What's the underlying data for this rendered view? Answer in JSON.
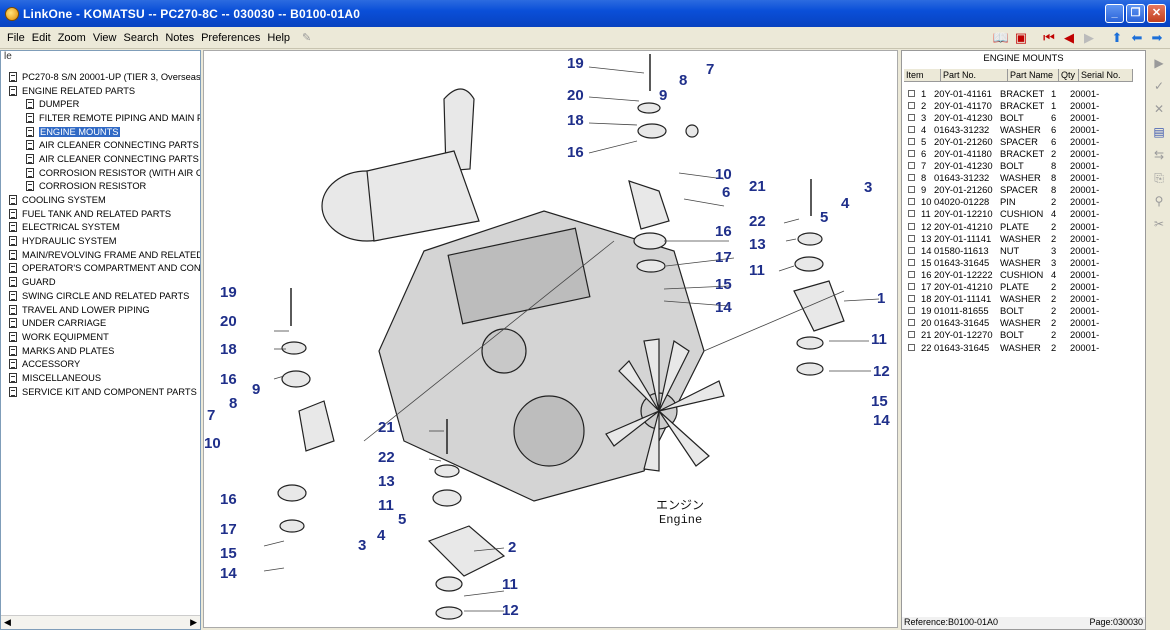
{
  "window": {
    "title": "LinkOne - KOMATSU -- PC270-8C -- 030030 -- B0100-01A0"
  },
  "menu": [
    "File",
    "Edit",
    "Zoom",
    "View",
    "Search",
    "Notes",
    "Preferences",
    "Help"
  ],
  "left_panel": {
    "header": "le",
    "tree": [
      {
        "label": "PC270-8 S/N 20001-UP (TIER 3, Overseas",
        "level": 1
      },
      {
        "label": "ENGINE RELATED PARTS",
        "level": 1
      },
      {
        "label": "DUMPER",
        "level": 2
      },
      {
        "label": "FILTER REMOTE PIPING AND MAIN PU",
        "level": 2
      },
      {
        "label": "ENGINE MOUNTS",
        "level": 2,
        "selected": true
      },
      {
        "label": "AIR CLEANER CONNECTING PARTS",
        "level": 2
      },
      {
        "label": "AIR CLEANER CONNECTING PARTS (W",
        "level": 2
      },
      {
        "label": "CORROSION RESISTOR (WITH AIR CC",
        "level": 2
      },
      {
        "label": "CORROSION RESISTOR",
        "level": 2
      },
      {
        "label": "COOLING SYSTEM",
        "level": 1
      },
      {
        "label": "FUEL TANK AND RELATED PARTS",
        "level": 1
      },
      {
        "label": "ELECTRICAL SYSTEM",
        "level": 1
      },
      {
        "label": "HYDRAULIC SYSTEM",
        "level": 1
      },
      {
        "label": "MAIN/REVOLVING FRAME AND RELATED P",
        "level": 1
      },
      {
        "label": "OPERATOR'S COMPARTMENT AND CONTR",
        "level": 1
      },
      {
        "label": "GUARD",
        "level": 1
      },
      {
        "label": "SWING CIRCLE AND RELATED PARTS",
        "level": 1
      },
      {
        "label": "TRAVEL AND LOWER PIPING",
        "level": 1
      },
      {
        "label": "UNDER CARRIAGE",
        "level": 1
      },
      {
        "label": "WORK EQUIPMENT",
        "level": 1
      },
      {
        "label": "MARKS AND PLATES",
        "level": 1
      },
      {
        "label": "ACCESSORY",
        "level": 1
      },
      {
        "label": "MISCELLANEOUS",
        "level": 1
      },
      {
        "label": "SERVICE KIT AND COMPONENT PARTS",
        "level": 1
      }
    ]
  },
  "diagram": {
    "caption_jp": "エンジン",
    "caption_en": "Engine",
    "callouts": [
      "19",
      "8",
      "7",
      "20",
      "9",
      "18",
      "16",
      "10",
      "6",
      "21",
      "3",
      "22",
      "5",
      "4",
      "16",
      "13",
      "17",
      "11",
      "15",
      "14",
      "1",
      "19",
      "20",
      "18",
      "16",
      "9",
      "7",
      "8",
      "10",
      "16",
      "17",
      "15",
      "14",
      "21",
      "22",
      "13",
      "11",
      "5",
      "2",
      "3",
      "4",
      "11",
      "12",
      "11",
      "12",
      "15",
      "14"
    ]
  },
  "parts_panel": {
    "title": "ENGINE MOUNTS",
    "columns": [
      "Item",
      "Part No.",
      "Part Name",
      "Qty",
      "Serial No."
    ],
    "rows": [
      [
        "1",
        "20Y-01-41161",
        "BRACKET",
        "1",
        "20001-"
      ],
      [
        "2",
        "20Y-01-41170",
        "BRACKET",
        "1",
        "20001-"
      ],
      [
        "3",
        "20Y-01-41230",
        "BOLT",
        "6",
        "20001-"
      ],
      [
        "4",
        "01643-31232",
        "WASHER",
        "6",
        "20001-"
      ],
      [
        "5",
        "20Y-01-21260",
        "SPACER",
        "6",
        "20001-"
      ],
      [
        "6",
        "20Y-01-41180",
        "BRACKET",
        "2",
        "20001-"
      ],
      [
        "7",
        "20Y-01-41230",
        "BOLT",
        "8",
        "20001-"
      ],
      [
        "8",
        "01643-31232",
        "WASHER",
        "8",
        "20001-"
      ],
      [
        "9",
        "20Y-01-21260",
        "SPACER",
        "8",
        "20001-"
      ],
      [
        "10",
        "04020-01228",
        "PIN",
        "2",
        "20001-"
      ],
      [
        "11",
        "20Y-01-12210",
        "CUSHION",
        "4",
        "20001-"
      ],
      [
        "12",
        "20Y-01-41210",
        "PLATE",
        "2",
        "20001-"
      ],
      [
        "13",
        "20Y-01-11141",
        "WASHER",
        "2",
        "20001-"
      ],
      [
        "14",
        "01580-11613",
        "NUT",
        "3",
        "20001-"
      ],
      [
        "15",
        "01643-31645",
        "WASHER",
        "3",
        "20001-"
      ],
      [
        "16",
        "20Y-01-12222",
        "CUSHION",
        "4",
        "20001-"
      ],
      [
        "17",
        "20Y-01-41210",
        "PLATE",
        "2",
        "20001-"
      ],
      [
        "18",
        "20Y-01-11141",
        "WASHER",
        "2",
        "20001-"
      ],
      [
        "19",
        "01011-81655",
        "BOLT",
        "2",
        "20001-"
      ],
      [
        "20",
        "01643-31645",
        "WASHER",
        "2",
        "20001-"
      ],
      [
        "21",
        "20Y-01-12270",
        "BOLT",
        "2",
        "20001-"
      ],
      [
        "22",
        "01643-31645",
        "WASHER",
        "2",
        "20001-"
      ]
    ],
    "reference": "Reference:B0100-01A0",
    "page": "Page:030030"
  },
  "colors": {
    "titlebar": "#0a4fd8",
    "selection": "#316ac5",
    "callout": "#1f2f8a"
  }
}
